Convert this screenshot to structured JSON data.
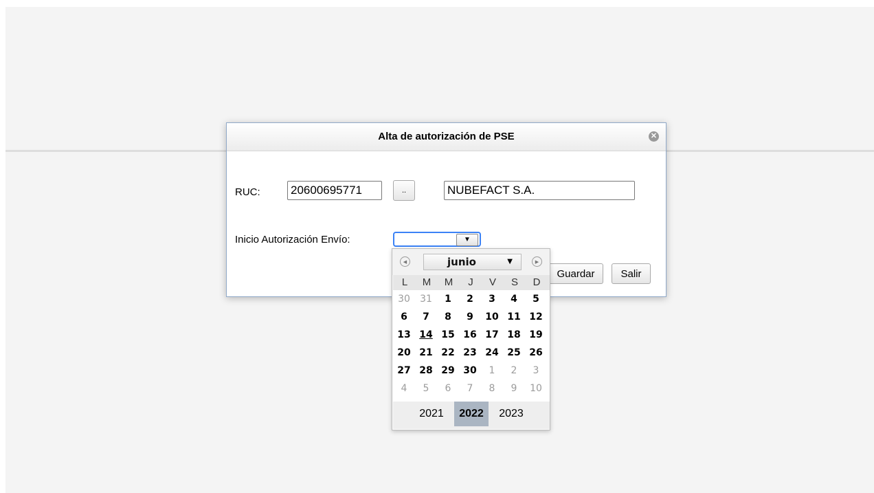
{
  "dialog": {
    "title": "Alta de autorización de PSE",
    "close_glyph": "✕",
    "ruc_label": "RUC:",
    "ruc_value": "20600695771",
    "lookup_label": "..",
    "company_name": "NUBEFACT S.A.",
    "start_label": "Inicio Autorización Envío:",
    "start_value": "",
    "save_label": "Guardar",
    "exit_label": "Salir"
  },
  "calendar": {
    "month": "junio",
    "weekdays": [
      "L",
      "M",
      "M",
      "J",
      "V",
      "S",
      "D"
    ],
    "weeks": [
      [
        "30",
        "31",
        "1",
        "2",
        "3",
        "4",
        "5"
      ],
      [
        "6",
        "7",
        "8",
        "9",
        "10",
        "11",
        "12"
      ],
      [
        "13",
        "14",
        "15",
        "16",
        "17",
        "18",
        "19"
      ],
      [
        "20",
        "21",
        "22",
        "23",
        "24",
        "25",
        "26"
      ],
      [
        "27",
        "28",
        "29",
        "30",
        "1",
        "2",
        "3"
      ],
      [
        "4",
        "5",
        "6",
        "7",
        "8",
        "9",
        "10"
      ]
    ],
    "today": "14",
    "years": [
      "2021",
      "2022",
      "2023"
    ],
    "selected_year": "2022"
  }
}
